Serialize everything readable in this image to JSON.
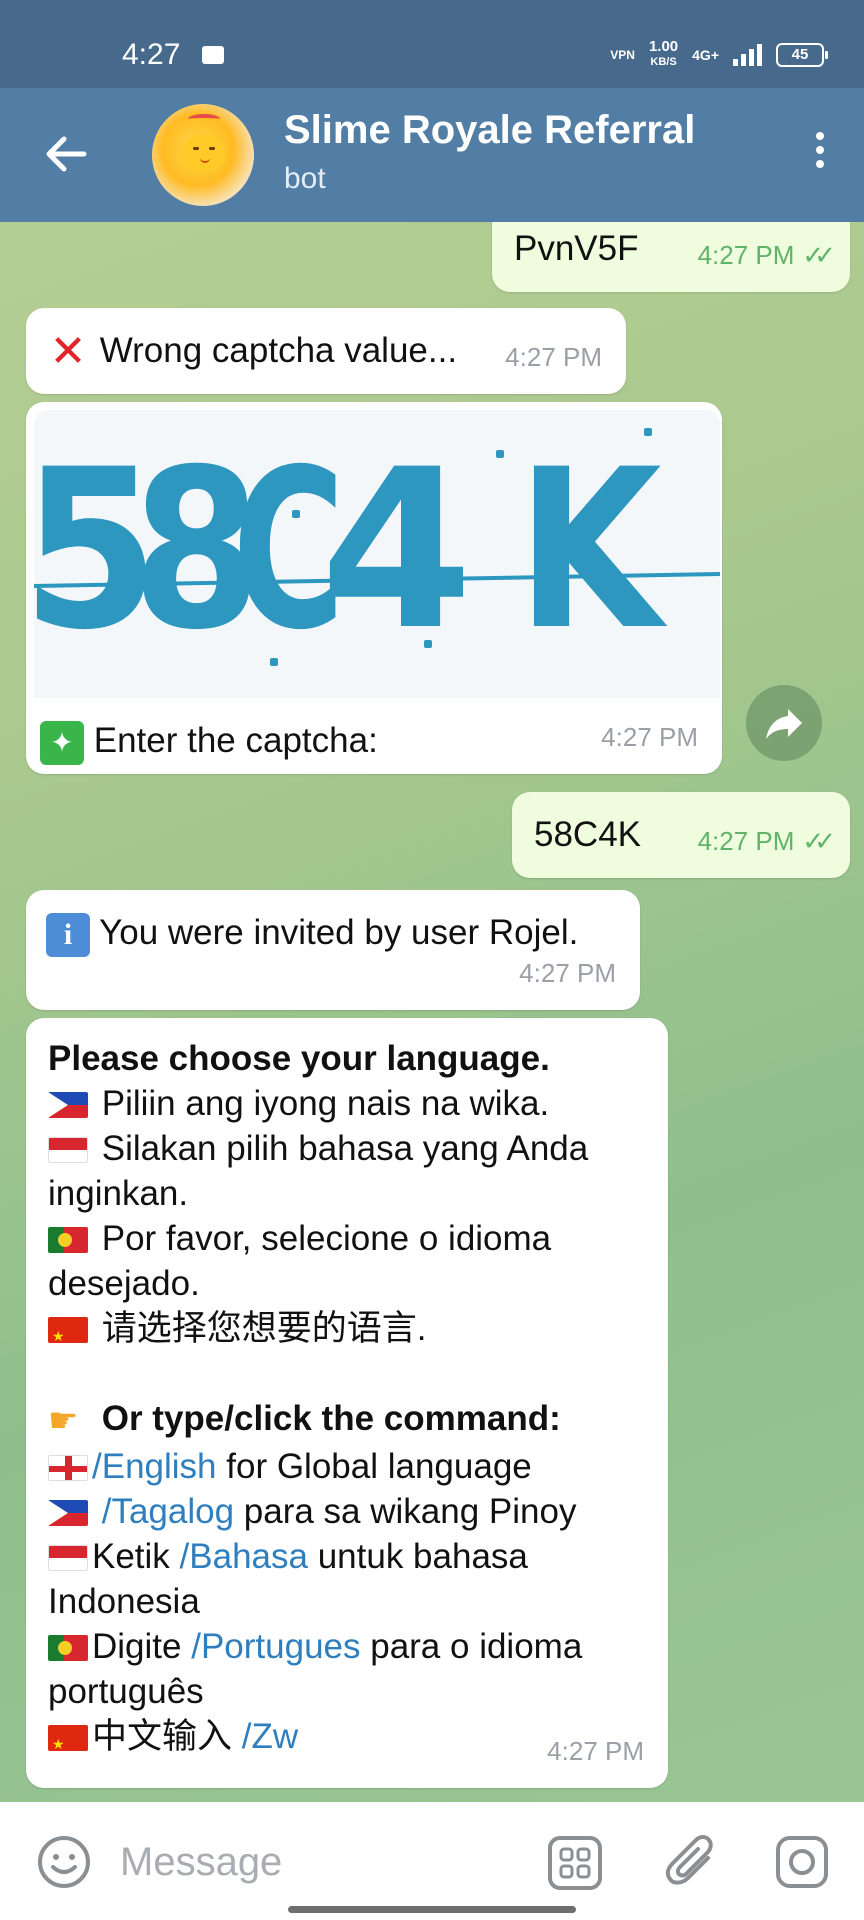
{
  "status_bar": {
    "time": "4:27",
    "vpn": "VPN",
    "speed_value": "1.00",
    "speed_unit": "KB/S",
    "network": "4G+",
    "battery": "45"
  },
  "header": {
    "title": "Slime Royale Referral",
    "subtitle": "bot"
  },
  "messages": {
    "m1": {
      "text": "PvnV5F",
      "time": "4:27 PM"
    },
    "m2": {
      "text": "Wrong captcha value...",
      "time": "4:27 PM"
    },
    "m3": {
      "captcha_chars": [
        "5",
        "8",
        "C",
        "4",
        "K"
      ],
      "text": "Enter the captcha:",
      "time": "4:27 PM"
    },
    "m4": {
      "text": "58C4K",
      "time": "4:27 PM"
    },
    "m5": {
      "text": "You were invited by user Rojel.",
      "time": "4:27 PM"
    },
    "m6": {
      "heading": "Please choose your language.",
      "line_ph": "Piliin ang iyong nais na wika.",
      "line_id": "Silakan pilih bahasa yang Anda inginkan.",
      "line_pt": "Por favor, selecione o idioma desejado.",
      "line_cn": "请选择您想要的语言.",
      "cmd_heading": "Or type/click the command:",
      "cmd_en": "/English",
      "cmd_en_rest": " for Global language",
      "cmd_tl": "/Tagalog",
      "cmd_tl_rest": " para sa wikang Pinoy",
      "cmd_id_pre": "Ketik ",
      "cmd_id": "/Bahasa",
      "cmd_id_rest": " untuk bahasa Indonesia",
      "cmd_pt_pre": "Digite ",
      "cmd_pt": "/Portugues",
      "cmd_pt_rest": " para o idioma português",
      "cmd_zw_pre": "中文输入 ",
      "cmd_zw": "/Zw",
      "time": "4:27 PM"
    }
  },
  "input": {
    "placeholder": "Message"
  },
  "colors": {
    "header_bg": "#527ea6",
    "status_bg": "#476a8c",
    "outgoing_bubble": "#effdde",
    "link": "#2f7fbf",
    "read_ticks": "#5fb46a"
  },
  "icons": [
    "back-arrow-icon",
    "more-vertical-icon",
    "share-icon",
    "emoji-icon",
    "bot-menu-icon",
    "attach-icon",
    "camera-icon"
  ]
}
